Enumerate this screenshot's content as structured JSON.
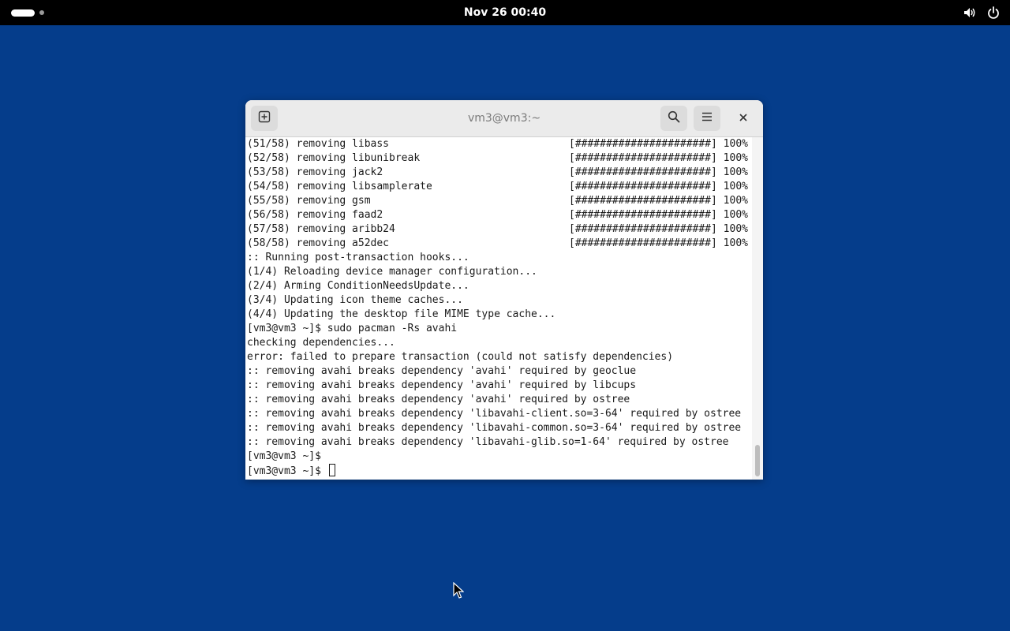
{
  "topbar": {
    "clock": "Nov 26  00:40",
    "icons": [
      "activities-indicator",
      "volume-icon",
      "power-icon"
    ]
  },
  "window": {
    "title": "vm3@vm3:~",
    "buttons": [
      "new-tab-icon",
      "search-icon",
      "menu-icon",
      "close-icon"
    ]
  },
  "terminal": {
    "lines": [
      "(51/58) removing libass",
      "(52/58) removing libunibreak",
      "(53/58) removing jack2",
      "(54/58) removing libsamplerate",
      "(55/58) removing gsm",
      "(56/58) removing faad2",
      "(57/58) removing aribb24",
      "(58/58) removing a52dec",
      ":: Running post-transaction hooks...",
      "(1/4) Reloading device manager configuration...",
      "(2/4) Arming ConditionNeedsUpdate...",
      "(3/4) Updating icon theme caches...",
      "(4/4) Updating the desktop file MIME type cache...",
      "[vm3@vm3 ~]$ sudo pacman -Rs avahi",
      "checking dependencies...",
      "error: failed to prepare transaction (could not satisfy dependencies)",
      ":: removing avahi breaks dependency 'avahi' required by geoclue",
      ":: removing avahi breaks dependency 'avahi' required by libcups",
      ":: removing avahi breaks dependency 'avahi' required by ostree",
      ":: removing avahi breaks dependency 'libavahi-client.so=3-64' required by ostree",
      ":: removing avahi breaks dependency 'libavahi-common.so=3-64' required by ostree",
      ":: removing avahi breaks dependency 'libavahi-glib.so=1-64' required by ostree",
      "[vm3@vm3 ~]$",
      "[vm3@vm3 ~]$ "
    ],
    "progress": [
      "[######################] 100%",
      "[######################] 100%",
      "[######################] 100%",
      "[######################] 100%",
      "[######################] 100%",
      "[######################] 100%",
      "[######################] 100%",
      "[######################] 100%"
    ]
  }
}
